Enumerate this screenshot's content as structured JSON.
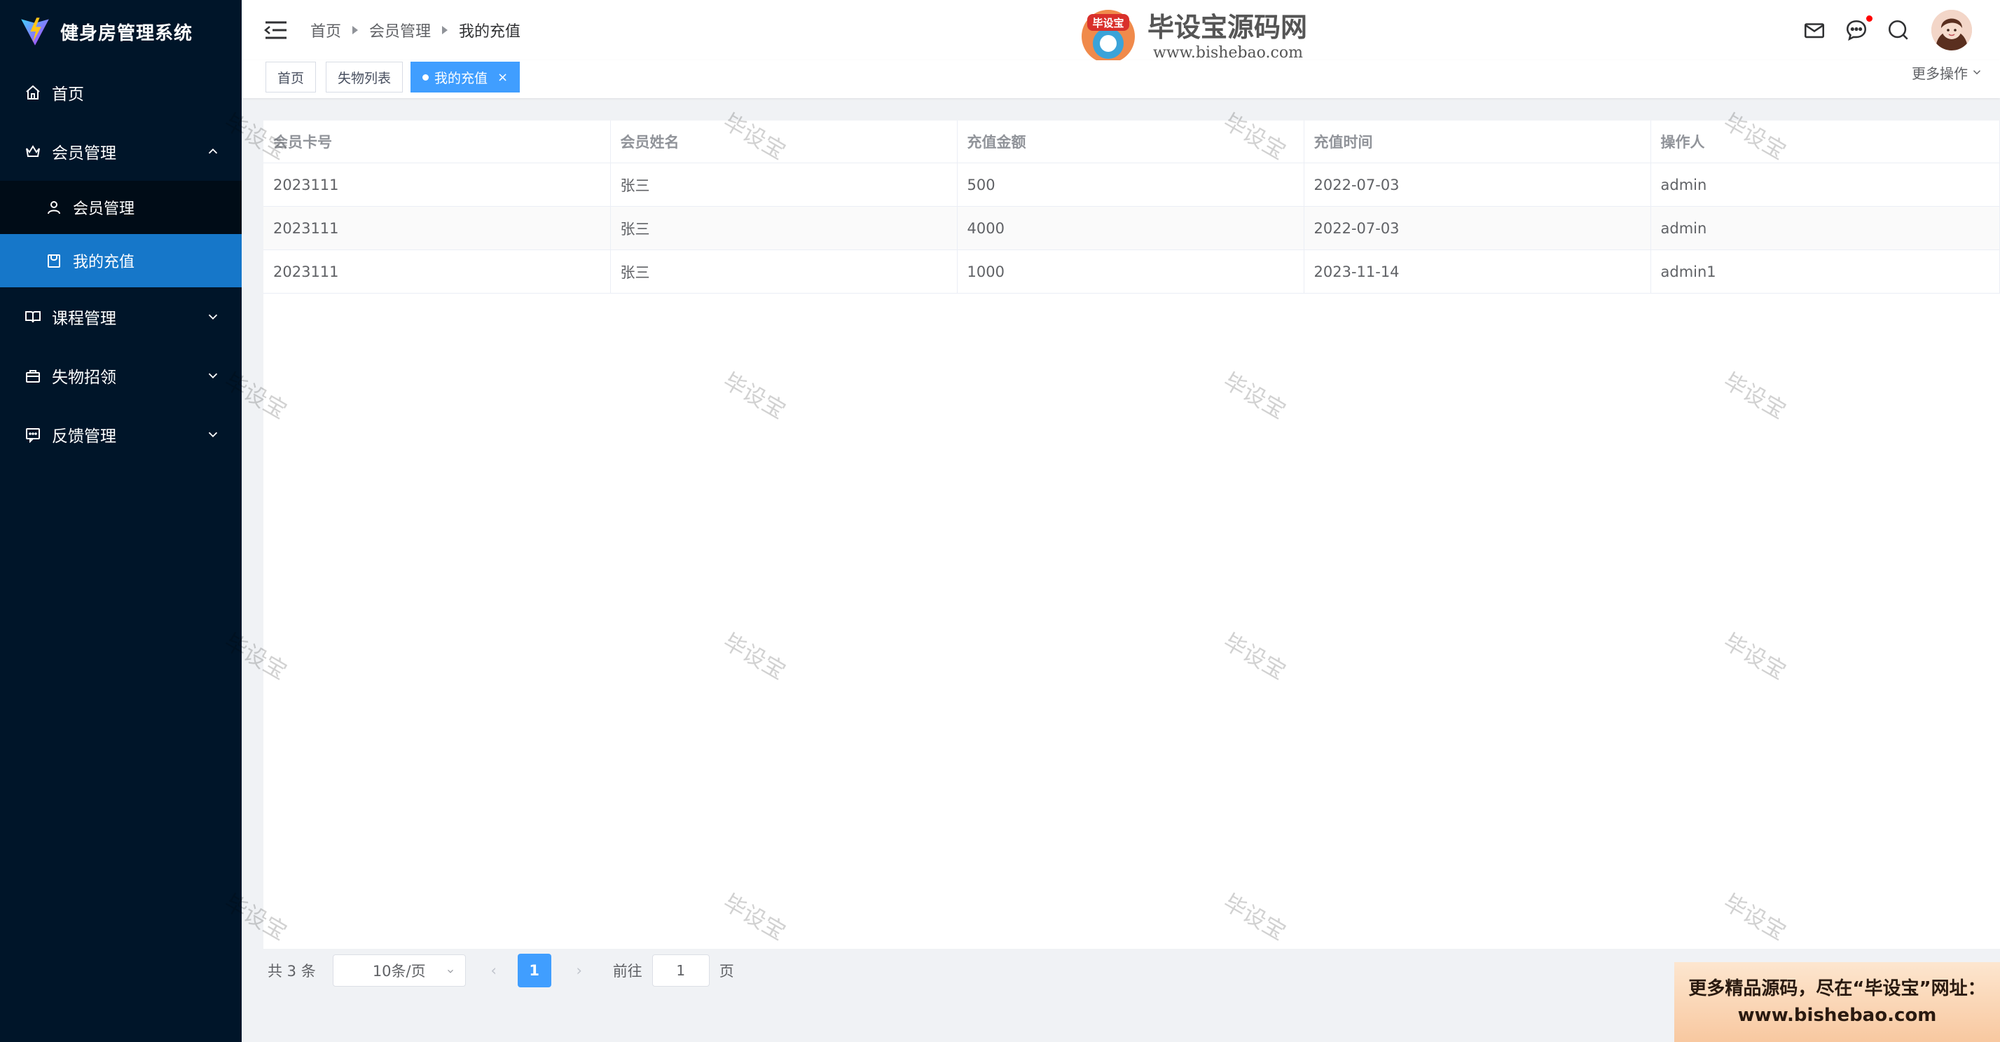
{
  "app": {
    "title": "健身房管理系统"
  },
  "sidebar": {
    "items": [
      {
        "label": "首页",
        "icon": "home-icon"
      },
      {
        "label": "会员管理",
        "icon": "crown-icon",
        "expanded": true
      },
      {
        "label": "课程管理",
        "icon": "book-icon"
      },
      {
        "label": "失物招领",
        "icon": "bag-icon"
      },
      {
        "label": "反馈管理",
        "icon": "comment-icon"
      }
    ],
    "sub_items": [
      {
        "label": "会员管理",
        "icon": "user-icon"
      },
      {
        "label": "我的充值",
        "icon": "wallet-icon",
        "active": true
      }
    ]
  },
  "header": {
    "breadcrumb": [
      "首页",
      "会员管理",
      "我的充值"
    ],
    "watermark_title": "毕设宝源码网",
    "watermark_url": "www.bishebao.com",
    "watermark_badge": "毕设宝"
  },
  "tags": {
    "items": [
      "首页",
      "失物列表",
      "我的充值"
    ],
    "active_index": 2,
    "close_label": "×",
    "more_ops": "更多操作"
  },
  "table": {
    "columns": [
      "会员卡号",
      "会员姓名",
      "充值金额",
      "充值时间",
      "操作人"
    ],
    "rows": [
      [
        "2023111",
        "张三",
        "500",
        "2022-07-03",
        "admin"
      ],
      [
        "2023111",
        "张三",
        "4000",
        "2022-07-03",
        "admin"
      ],
      [
        "2023111",
        "张三",
        "1000",
        "2023-11-14",
        "admin1"
      ]
    ]
  },
  "pagination": {
    "total": "共 3 条",
    "page_size": "10条/页",
    "prev": "‹",
    "current_page": "1",
    "next": "›",
    "goto_label": "前往",
    "goto_value": "1",
    "page_suffix": "页"
  },
  "promo": {
    "line1": "更多精品源码，尽在“毕设宝”网址：",
    "line2": "www.bishebao.com"
  },
  "watermark_text": "毕设宝",
  "colors": {
    "sidebar_bg": "#001529",
    "active_menu": "#1677c9",
    "primary": "#409eff"
  }
}
